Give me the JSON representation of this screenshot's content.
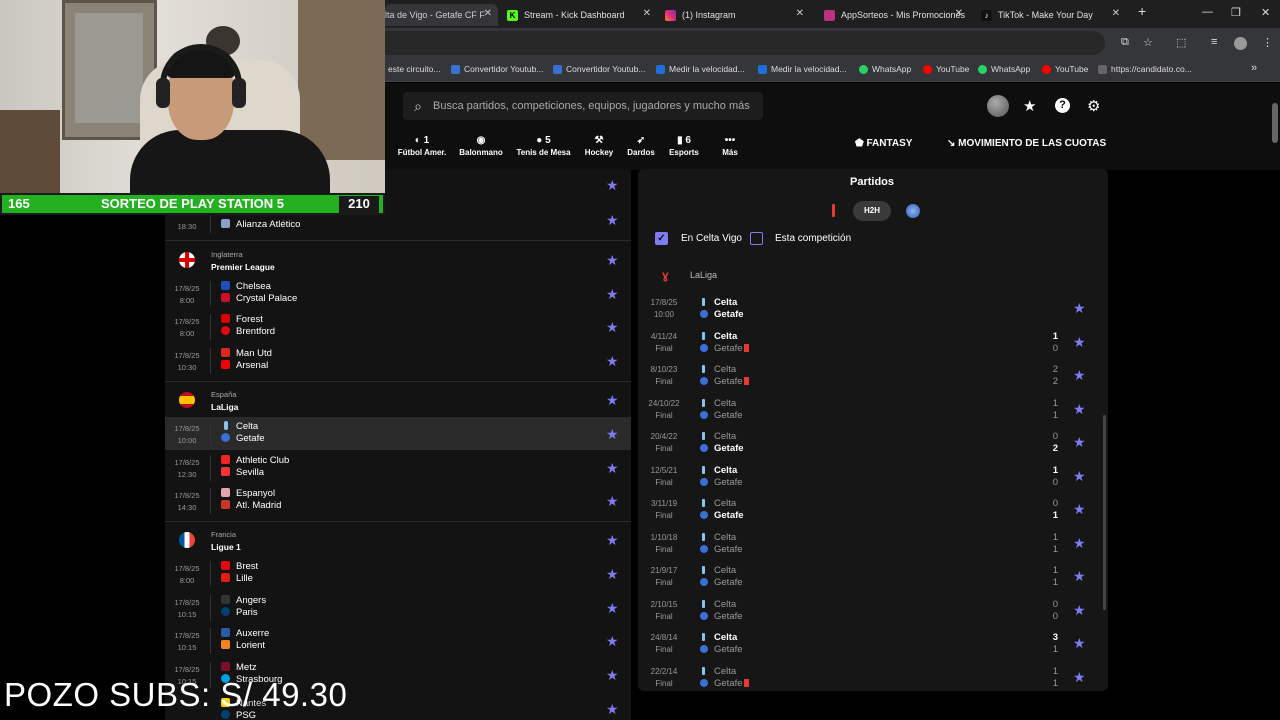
{
  "browser": {
    "tabs": [
      {
        "label": "lta de Vigo - Getafe CF F",
        "active": true
      },
      {
        "label": "Stream - Kick Dashboard"
      },
      {
        "label": "(1) Instagram"
      },
      {
        "label": "AppSorteos - Mis Promociones"
      },
      {
        "label": "TikTok - Make Your Day"
      }
    ],
    "bookmarks": [
      "este circuito...",
      "Convertidor Youtub...",
      "Convertidor Youtub...",
      "Medir la velocidad...",
      "Medir la velocidad...",
      "WhatsApp",
      "YouTube",
      "WhatsApp",
      "YouTube",
      "https://candidato.co..."
    ]
  },
  "site": {
    "search_placeholder": "Busca partidos, competiciones, equipos, jugadores y mucho más",
    "sports": [
      {
        "count": "1",
        "label": "Fútbol Amer."
      },
      {
        "count": "",
        "label": "Balonmano"
      },
      {
        "count": "5",
        "label": "Tenis de Mesa"
      },
      {
        "count": "",
        "label": "Hockey"
      },
      {
        "count": "",
        "label": "Dardos"
      },
      {
        "count": "6",
        "label": "Esports"
      },
      {
        "count": "",
        "label": "Más"
      }
    ],
    "fantasy_label": "FANTASY",
    "odds_label": "MOVIMIENTO DE LAS CUOTAS"
  },
  "leftlist": {
    "top_match": {
      "time": "18:30",
      "team": "Alianza Atlético"
    },
    "leagues": [
      {
        "country": "Inglaterra",
        "name": "Premier League",
        "matches": [
          {
            "date": "17/8/25",
            "time": "8:00",
            "home": "Chelsea",
            "away": "Crystal Palace"
          },
          {
            "date": "17/8/25",
            "time": "8:00",
            "home": "Forest",
            "away": "Brentford"
          },
          {
            "date": "17/8/25",
            "time": "10:30",
            "home": "Man Utd",
            "away": "Arsenal"
          }
        ]
      },
      {
        "country": "España",
        "name": "LaLiga",
        "matches": [
          {
            "date": "17/8/25",
            "time": "10:00",
            "home": "Celta",
            "away": "Getafe"
          },
          {
            "date": "17/8/25",
            "time": "12:30",
            "home": "Athletic Club",
            "away": "Sevilla"
          },
          {
            "date": "17/8/25",
            "time": "14:30",
            "home": "Espanyol",
            "away": "Atl. Madrid"
          }
        ]
      },
      {
        "country": "Francia",
        "name": "Ligue 1",
        "matches": [
          {
            "date": "17/8/25",
            "time": "8:00",
            "home": "Brest",
            "away": "Lille"
          },
          {
            "date": "17/8/25",
            "time": "10:15",
            "home": "Angers",
            "away": "Paris"
          },
          {
            "date": "17/8/25",
            "time": "10:15",
            "home": "Auxerre",
            "away": "Lorient"
          },
          {
            "date": "17/8/25",
            "time": "10:15",
            "home": "Metz",
            "away": "Strasbourg"
          }
        ]
      }
    ],
    "bottom_partial": {
      "team_a": "Nantes",
      "team_b": "PSG"
    }
  },
  "panel": {
    "title": "Partidos",
    "h2h_label": "H2H",
    "filter_team": "En Celta Vigo",
    "filter_comp": "Esta competición",
    "league": "LaLiga",
    "matches": [
      {
        "date": "17/8/25",
        "status": "10:00",
        "home": "Celta",
        "away": "Getafe",
        "hs": "",
        "as": "",
        "upcoming": true
      },
      {
        "date": "4/11/24",
        "status": "Final",
        "home": "Celta",
        "away": "Getafe",
        "hs": "1",
        "as": "0",
        "winner": "home",
        "card": "away"
      },
      {
        "date": "8/10/23",
        "status": "Final",
        "home": "Celta",
        "away": "Getafe",
        "hs": "2",
        "as": "2",
        "winner": "none",
        "card": "away"
      },
      {
        "date": "24/10/22",
        "status": "Final",
        "home": "Celta",
        "away": "Getafe",
        "hs": "1",
        "as": "1",
        "winner": "none"
      },
      {
        "date": "20/4/22",
        "status": "Final",
        "home": "Celta",
        "away": "Getafe",
        "hs": "0",
        "as": "2",
        "winner": "away"
      },
      {
        "date": "12/5/21",
        "status": "Final",
        "home": "Celta",
        "away": "Getafe",
        "hs": "1",
        "as": "0",
        "winner": "home"
      },
      {
        "date": "3/11/19",
        "status": "Final",
        "home": "Celta",
        "away": "Getafe",
        "hs": "0",
        "as": "1",
        "winner": "away"
      },
      {
        "date": "1/10/18",
        "status": "Final",
        "home": "Celta",
        "away": "Getafe",
        "hs": "1",
        "as": "1",
        "winner": "none"
      },
      {
        "date": "21/9/17",
        "status": "Final",
        "home": "Celta",
        "away": "Getafe",
        "hs": "1",
        "as": "1",
        "winner": "none"
      },
      {
        "date": "2/10/15",
        "status": "Final",
        "home": "Celta",
        "away": "Getafe",
        "hs": "0",
        "as": "0",
        "winner": "none"
      },
      {
        "date": "24/8/14",
        "status": "Final",
        "home": "Celta",
        "away": "Getafe",
        "hs": "3",
        "as": "1",
        "winner": "home"
      },
      {
        "date": "22/2/14",
        "status": "Final",
        "home": "Celta",
        "away": "Getafe",
        "hs": "1",
        "as": "1",
        "winner": "none",
        "card": "away"
      }
    ]
  },
  "overlay": {
    "left_count": "165",
    "banner": "SORTEO DE PLAY STATION 5",
    "right_count": "210",
    "pozo": "POZO SUBS: S/ 49.30"
  },
  "colors": {
    "accent": "#7d7cf2",
    "banner_green": "#23b021",
    "red_card": "#e53935"
  }
}
